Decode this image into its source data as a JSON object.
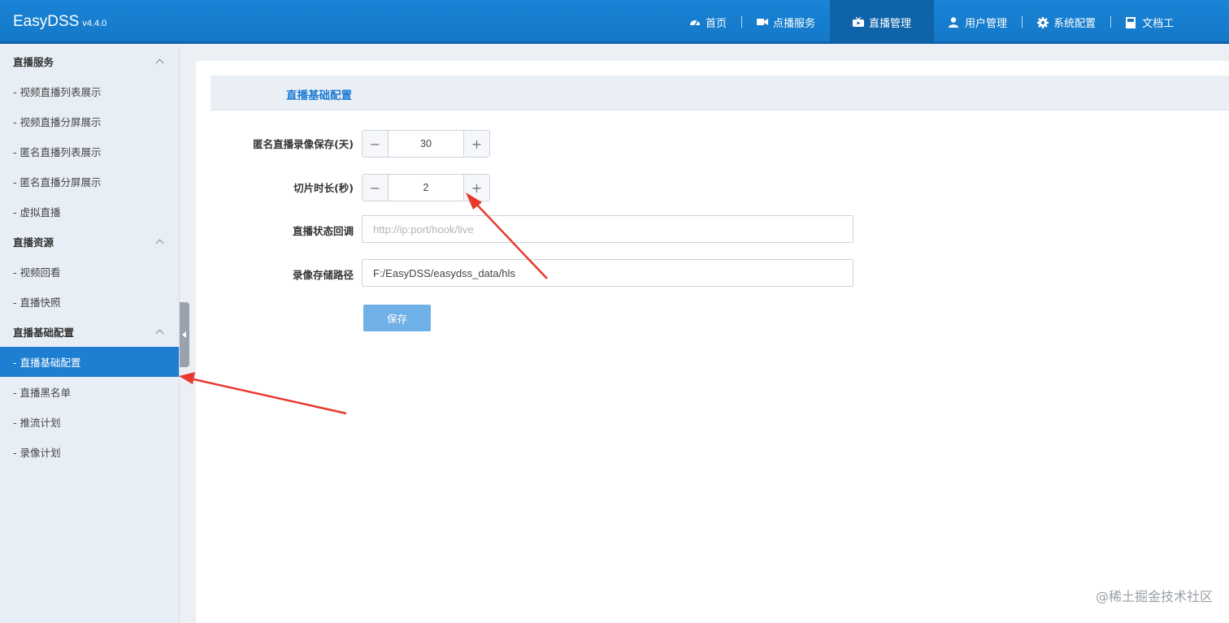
{
  "header": {
    "brand": "EasyDSS",
    "version": "v4.4.0",
    "nav": [
      {
        "icon": "dashboard-icon",
        "label": "首页",
        "active": false
      },
      {
        "icon": "video-camera-icon",
        "label": "点播服务",
        "active": false
      },
      {
        "icon": "tv-icon",
        "label": "直播管理",
        "active": true
      },
      {
        "icon": "user-icon",
        "label": "用户管理",
        "active": false
      },
      {
        "icon": "gear-icon",
        "label": "系统配置",
        "active": false
      },
      {
        "icon": "document-icon",
        "label": "文档工",
        "active": false
      }
    ]
  },
  "sidebar": {
    "groups": [
      {
        "title": "直播服务",
        "items": [
          "- 视频直播列表展示",
          "- 视频直播分屏展示",
          "- 匿名直播列表展示",
          "- 匿名直播分屏展示",
          "- 虚拟直播"
        ]
      },
      {
        "title": "直播资源",
        "items": [
          "- 视频回看",
          "- 直播快照"
        ]
      },
      {
        "title": "直播基础配置",
        "items": [
          "- 直播基础配置",
          "- 直播黑名单",
          "- 推流计划",
          "- 录像计划"
        ]
      }
    ],
    "active_item": "- 直播基础配置"
  },
  "panel": {
    "title": "直播基础配置",
    "fields": {
      "record_keep_label": "匿名直播录像保存(天)",
      "record_keep_value": "30",
      "slice_duration_label": "切片时长(秒)",
      "slice_duration_value": "2",
      "callback_label": "直播状态回调",
      "callback_placeholder": "http://ip:port/hook/live",
      "callback_value": "",
      "storage_path_label": "录像存储路径",
      "storage_path_value": "F:/EasyDSS/easydss_data/hls"
    },
    "save_label": "保存"
  },
  "stepper_symbols": {
    "minus": "−",
    "plus": "+"
  },
  "watermark": "@稀土掘金技术社区",
  "colors": {
    "header_bg": "#1478c8",
    "nav_active_bg": "#0f63a8",
    "sidebar_active_bg": "#1e7fd2",
    "title_blue": "#1b7bd4",
    "save_button_bg": "#6fb0e6",
    "arrow_red": "#e8392f"
  }
}
